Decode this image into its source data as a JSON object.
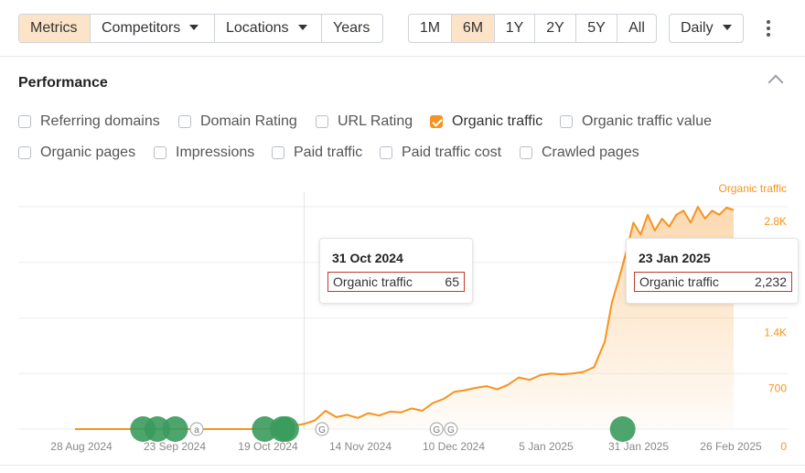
{
  "toolbar": {
    "segments": [
      {
        "label": "Metrics",
        "active": true
      },
      {
        "label": "Competitors",
        "active": false
      },
      {
        "label": "Locations",
        "active": false
      },
      {
        "label": "Years",
        "active": false
      }
    ],
    "periods": [
      {
        "label": "1M",
        "active": false
      },
      {
        "label": "6M",
        "active": true
      },
      {
        "label": "1Y",
        "active": false
      },
      {
        "label": "2Y",
        "active": false
      },
      {
        "label": "5Y",
        "active": false
      },
      {
        "label": "All",
        "active": false
      }
    ],
    "granularity": "Daily",
    "more_icon": "vertical-dots-icon"
  },
  "panel": {
    "title": "Performance",
    "collapse_icon": "chevron-up-icon",
    "checkboxes": [
      {
        "label": "Referring domains",
        "checked": false
      },
      {
        "label": "Domain Rating",
        "checked": false
      },
      {
        "label": "URL Rating",
        "checked": false
      },
      {
        "label": "Organic traffic",
        "checked": true
      },
      {
        "label": "Organic traffic value",
        "checked": false
      },
      {
        "label": "Organic pages",
        "checked": false
      },
      {
        "label": "Impressions",
        "checked": false
      },
      {
        "label": "Paid traffic",
        "checked": false
      },
      {
        "label": "Paid traffic cost",
        "checked": false
      },
      {
        "label": "Crawled pages",
        "checked": false
      }
    ]
  },
  "colors": {
    "accent": "#f7931e",
    "active_bg": "#fde4c8",
    "event_marker": "#3a9b5d",
    "tooltip_border": "#c0392b"
  },
  "chart_data": {
    "type": "area",
    "series": [
      {
        "name": "Organic traffic",
        "x": [
          "2024-08-28",
          "2024-09-05",
          "2024-09-12",
          "2024-09-19",
          "2024-09-26",
          "2024-10-03",
          "2024-10-10",
          "2024-10-17",
          "2024-10-24",
          "2024-10-31",
          "2024-11-03",
          "2024-11-06",
          "2024-11-09",
          "2024-11-12",
          "2024-11-15",
          "2024-11-18",
          "2024-11-21",
          "2024-11-24",
          "2024-11-27",
          "2024-11-30",
          "2024-12-03",
          "2024-12-06",
          "2024-12-09",
          "2024-12-12",
          "2024-12-15",
          "2024-12-18",
          "2024-12-21",
          "2024-12-24",
          "2024-12-27",
          "2024-12-30",
          "2025-01-02",
          "2025-01-05",
          "2025-01-08",
          "2025-01-11",
          "2025-01-14",
          "2025-01-17",
          "2025-01-20",
          "2025-01-23",
          "2025-01-25",
          "2025-01-27",
          "2025-01-29",
          "2025-01-31",
          "2025-02-02",
          "2025-02-04",
          "2025-02-06",
          "2025-02-08",
          "2025-02-10",
          "2025-02-12",
          "2025-02-14",
          "2025-02-16",
          "2025-02-18",
          "2025-02-20",
          "2025-02-22",
          "2025-02-24",
          "2025-02-26",
          "2025-02-28"
        ],
        "y": [
          0,
          0,
          0,
          0,
          0,
          0,
          0,
          0,
          10,
          65,
          110,
          230,
          150,
          180,
          140,
          200,
          170,
          220,
          210,
          260,
          230,
          330,
          380,
          470,
          490,
          520,
          540,
          500,
          560,
          650,
          620,
          680,
          700,
          690,
          700,
          720,
          780,
          1100,
          1600,
          1900,
          2232,
          2600,
          2450,
          2700,
          2500,
          2650,
          2550,
          2700,
          2750,
          2600,
          2800,
          2650,
          2750,
          2700,
          2790,
          2760
        ]
      }
    ],
    "x_ticks": [
      "28 Aug 2024",
      "23 Sep 2024",
      "19 Oct 2024",
      "14 Nov 2024",
      "10 Dec 2024",
      "5 Jan 2025",
      "31 Jan 2025",
      "26 Feb 2025"
    ],
    "y_ticks": [
      "0",
      "700",
      "1.4K",
      "2.8K"
    ],
    "y_axis_side": "right",
    "ylim": [
      0,
      2800
    ],
    "xlim": [
      "2024-08-28",
      "2025-02-28"
    ],
    "grid": true,
    "annotations": [
      {
        "date": "31 Oct 2024",
        "label": "Organic traffic",
        "value": "65"
      },
      {
        "date": "23 Jan 2025",
        "label": "Organic traffic",
        "value": "2,232"
      }
    ],
    "event_markers": [
      {
        "x": "2024-09-16",
        "kind": "green"
      },
      {
        "x": "2024-09-20",
        "kind": "green"
      },
      {
        "x": "2024-09-25",
        "kind": "green"
      },
      {
        "x": "2024-10-01",
        "kind": "letter",
        "letter": "a"
      },
      {
        "x": "2024-10-20",
        "kind": "green"
      },
      {
        "x": "2024-10-25",
        "kind": "green"
      },
      {
        "x": "2024-10-26",
        "kind": "green"
      },
      {
        "x": "2024-11-05",
        "kind": "letter",
        "letter": "G"
      },
      {
        "x": "2024-12-07",
        "kind": "letter",
        "letter": "G"
      },
      {
        "x": "2024-12-11",
        "kind": "letter",
        "letter": "G"
      },
      {
        "x": "2025-01-28",
        "kind": "green"
      }
    ]
  }
}
